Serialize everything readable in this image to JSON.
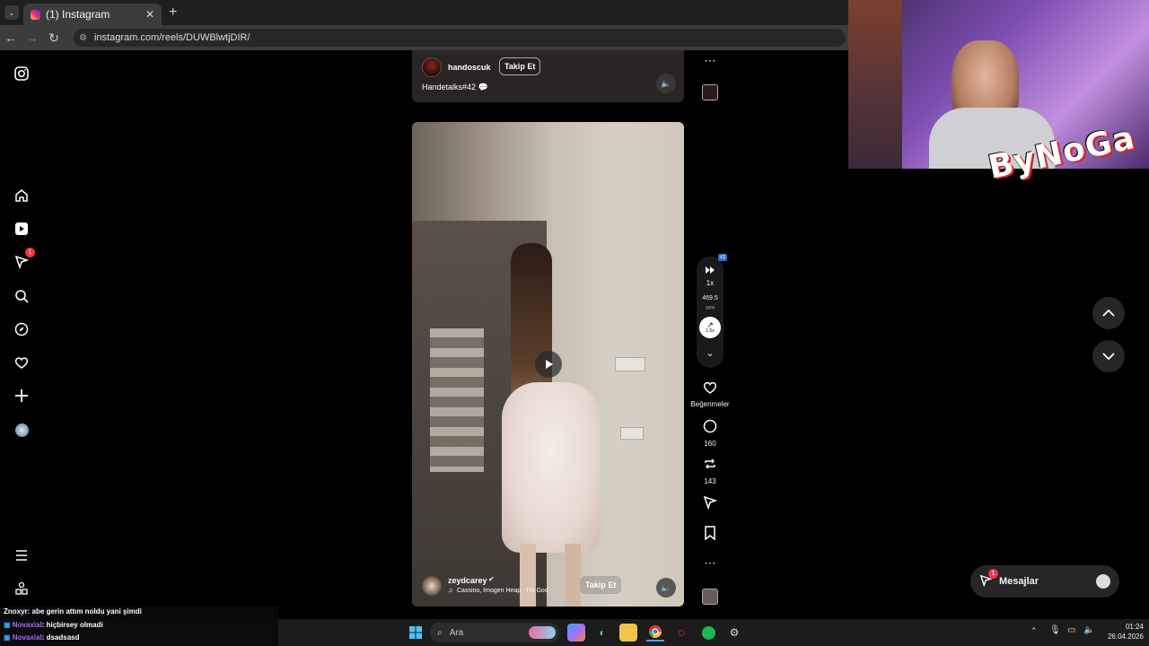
{
  "browser": {
    "tab_title": "(1) Instagram",
    "url": "instagram.com/reels/DUWBlwtjDIR/"
  },
  "sidebar": {
    "notifications_badge": "1"
  },
  "reel_top": {
    "username": "handoscuk",
    "follow_label": "Takip Et",
    "caption": "Handetalks#42 💬"
  },
  "reel_main": {
    "username": "zeydcarey",
    "music": "Cassino, Imogen Heap · I'm God",
    "follow_label": "Takip Et"
  },
  "actions": {
    "speed_badge": "x1",
    "speed_value": "1x",
    "vph_value": "469.5",
    "vph_unit": "VPH",
    "boost_value": "1.5x",
    "likes_label": "Beğenmeler",
    "comments_count": "160",
    "reposts_count": "143"
  },
  "overlay": {
    "logo_text": "ByNoGa"
  },
  "messages": {
    "label": "Mesajlar",
    "badge": "1"
  },
  "chat": {
    "lines": [
      {
        "user": "Znoxyr",
        "text": ": abe gerin attım noldu yani şimdi"
      },
      {
        "user": "Novaxial",
        "text": ": hiçbirsey olmadi"
      },
      {
        "user": "Novaxial",
        "text": ": dsadsasd"
      }
    ]
  },
  "taskbar": {
    "search_placeholder": "Ara",
    "time": "01:24",
    "date": "26.04.2026"
  }
}
